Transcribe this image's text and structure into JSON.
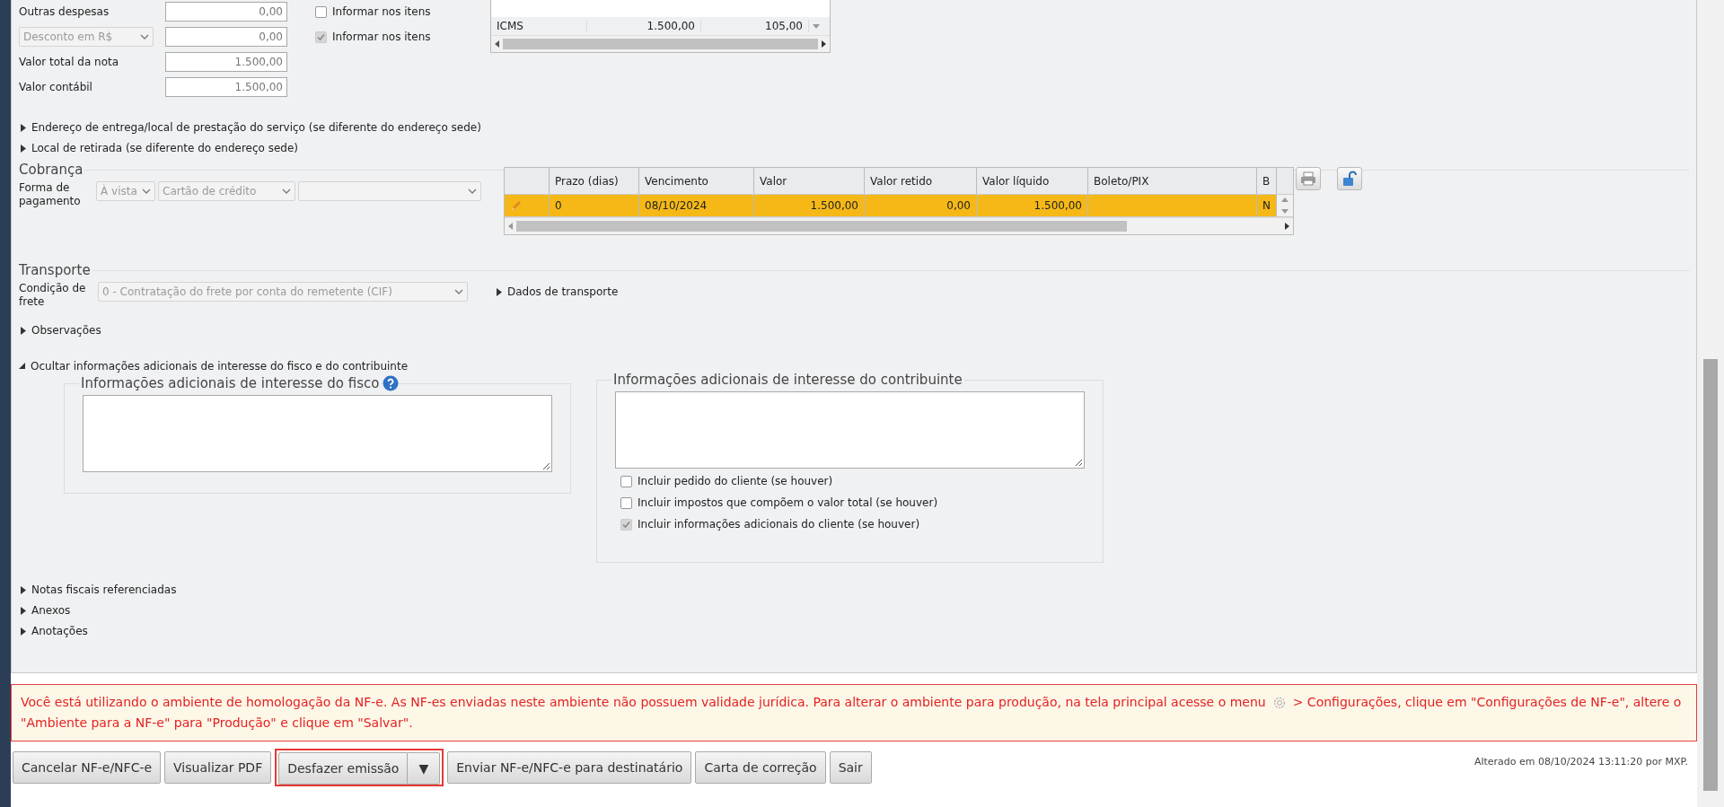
{
  "totals": [
    {
      "kind": "label",
      "label": "Outras despesas",
      "value": "0,00"
    },
    {
      "kind": "select",
      "label": "Desconto em R$",
      "value": "0,00"
    },
    {
      "kind": "label",
      "label": "Valor total da nota",
      "value": "1.500,00"
    },
    {
      "kind": "label",
      "label": "Valor contábil",
      "value": "1.500,00"
    }
  ],
  "informar": [
    {
      "label": "Informar nos itens",
      "checked": false,
      "disabled": false
    },
    {
      "label": "Informar nos itens",
      "checked": true,
      "disabled": true
    }
  ],
  "tax_table": {
    "rows": [
      [
        "ICMS",
        "1.500,00",
        "105,00"
      ]
    ]
  },
  "sections_top": [
    {
      "label": "Endereço de entrega/local de prestação do serviço (se diferente do endereço sede)",
      "expanded": false
    },
    {
      "label": "Local de retirada (se diferente do endereço sede)",
      "expanded": false
    }
  ],
  "cobranca": {
    "legend": "Cobrança",
    "label": "Forma de pagamento",
    "selects": [
      {
        "value": "À vista",
        "disabled": true
      },
      {
        "value": "Cartão de crédito",
        "disabled": true
      },
      {
        "disabled": true
      }
    ],
    "columns": [
      "Prazo (dias)",
      "Vencimento",
      "Valor",
      "Valor retido",
      "Valor líquido",
      "Boleto/PIX",
      "B"
    ],
    "rows": [
      {
        "selected": true,
        "cells": [
          "0",
          "08/10/2024",
          "1.500,00",
          "0,00",
          "1.500,00",
          null,
          "N"
        ]
      }
    ]
  },
  "transporte": {
    "legend": "Transporte",
    "label": "Condição de frete",
    "select": {
      "value": "0 - Contratação do frete por conta do remetente (CIF)",
      "disabled": true
    },
    "link": {
      "label": "Dados de transporte",
      "expanded": false
    }
  },
  "sections_mid": [
    {
      "label": "Observações",
      "expanded": false
    },
    {
      "label": "Ocultar informações adicionais de interesse do fisco e do contribuinte",
      "expanded": true
    }
  ],
  "fisco": {
    "legend": "Informações adicionais de interesse do fisco",
    "help": true
  },
  "contribuinte": {
    "legend": "Informações adicionais de interesse do contribuinte",
    "checkboxes": [
      {
        "label": "Incluir pedido do cliente (se houver)",
        "checked": false,
        "disabled": false
      },
      {
        "label": "Incluir impostos que compõem o valor total (se houver)",
        "checked": false,
        "disabled": false
      },
      {
        "label": "Incluir informações adicionais do cliente (se houver)",
        "checked": true,
        "disabled": true
      }
    ]
  },
  "sections_bottom": [
    {
      "label": "Notas fiscais referenciadas",
      "expanded": false
    },
    {
      "label": "Anexos",
      "expanded": false
    },
    {
      "label": "Anotações",
      "expanded": false
    }
  ],
  "warning": {
    "before": "Você está utilizando o ambiente de homologação da NF-e. As NF-es enviadas neste ambiente não possuem validade jurídica. Para alterar o ambiente para produção, na tela principal acesse o menu",
    "after": "> Configurações, clique em \"Configurações de NF-e\", altere o \"Ambiente para a NF-e\" para \"Produção\" e clique em \"Salvar\"."
  },
  "buttons": [
    {
      "kind": "button",
      "label": "Cancelar NF-e/NFC-e",
      "highlighted": false
    },
    {
      "kind": "button",
      "label": "Visualizar PDF",
      "highlighted": false
    },
    {
      "kind": "split",
      "label": "Desfazer emissão",
      "caret": "▼",
      "highlighted": true
    },
    {
      "kind": "button",
      "label": "Enviar NF-e/NFC-e para destinatário",
      "highlighted": false
    },
    {
      "kind": "button",
      "label": "Carta de correção",
      "highlighted": false
    },
    {
      "kind": "button",
      "label": "Sair",
      "highlighted": false
    }
  ],
  "status": "Alterado em 08/10/2024 13:11:20 por MXP."
}
